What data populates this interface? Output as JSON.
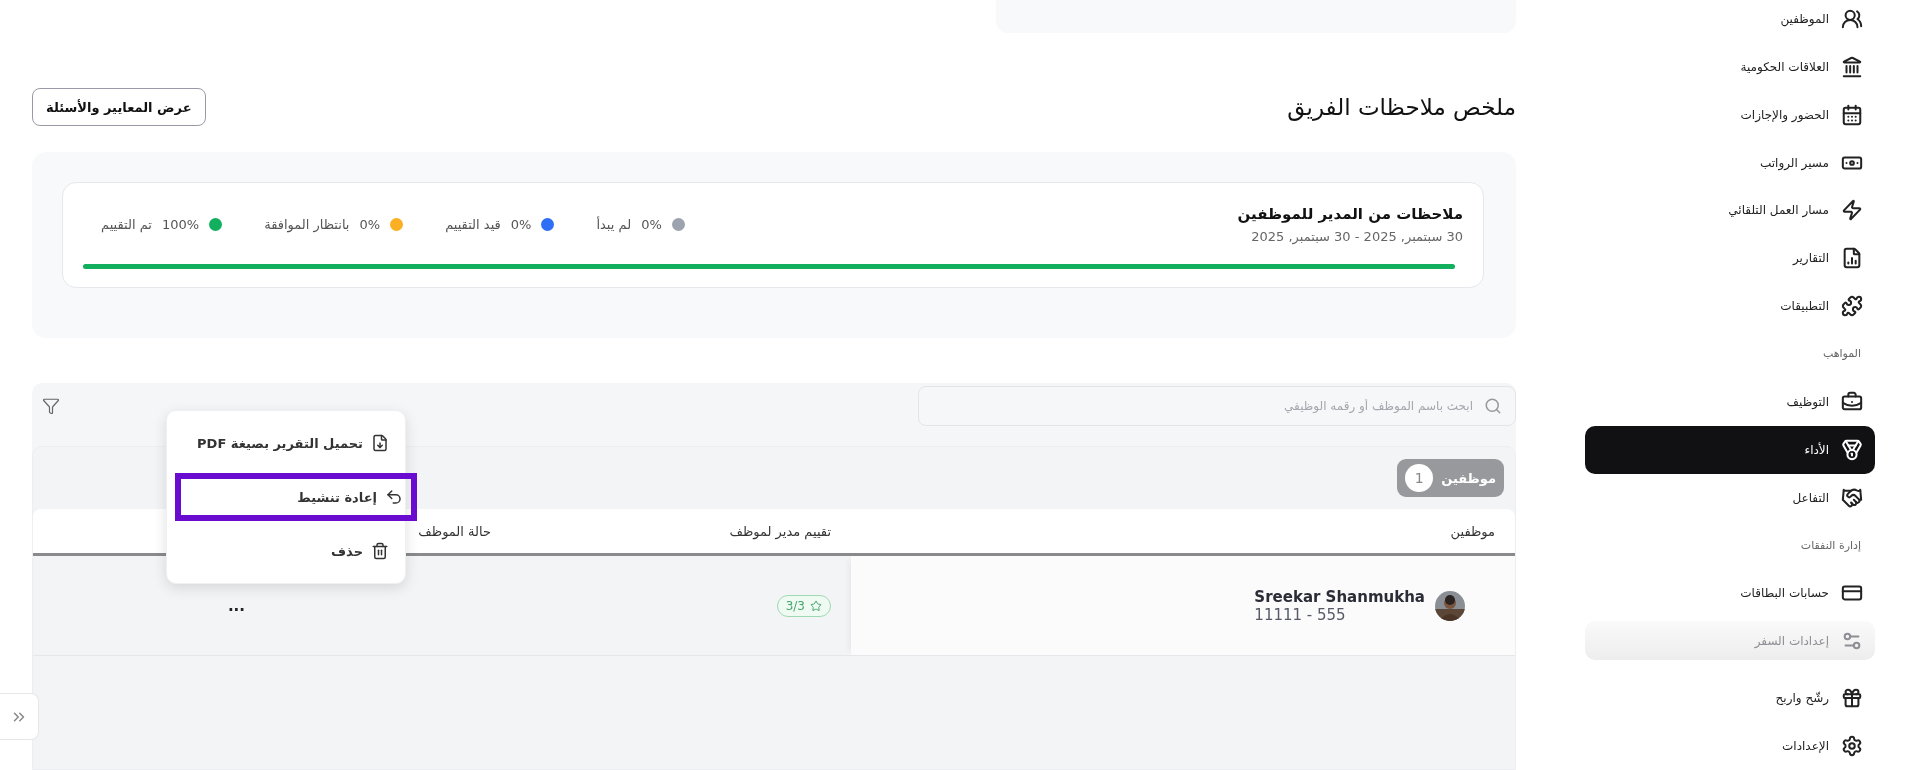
{
  "sidebar": {
    "items": [
      {
        "kind": "link",
        "label": "الموظفين",
        "selected": false,
        "disabled": false
      },
      {
        "kind": "link",
        "label": "العلاقات الحكومية",
        "selected": false,
        "disabled": false
      },
      {
        "kind": "link",
        "label": "الحضور والإجازات",
        "selected": false,
        "disabled": false
      },
      {
        "kind": "link",
        "label": "مسير الرواتب",
        "selected": false,
        "disabled": false
      },
      {
        "kind": "link",
        "label": "مسار العمل التلقائي",
        "selected": false,
        "disabled": false
      },
      {
        "kind": "link",
        "label": "التقارير",
        "selected": false,
        "disabled": false
      },
      {
        "kind": "link",
        "label": "التطبيقات",
        "selected": false,
        "disabled": false
      },
      {
        "kind": "section",
        "label": "المواهب"
      },
      {
        "kind": "link",
        "label": "التوظيف",
        "selected": false,
        "disabled": false
      },
      {
        "kind": "link",
        "label": "الأداء",
        "selected": true,
        "disabled": false
      },
      {
        "kind": "link",
        "label": "التفاعل",
        "selected": false,
        "disabled": false
      },
      {
        "kind": "section",
        "label": "إدارة النفقات"
      },
      {
        "kind": "link",
        "label": "حسابات البطاقات",
        "selected": false,
        "disabled": false
      },
      {
        "kind": "link",
        "label": "إعدادات السفر",
        "selected": false,
        "disabled": true
      },
      {
        "kind": "link",
        "label": "رشّح واربح",
        "selected": false,
        "disabled": false
      },
      {
        "kind": "link",
        "label": "الإعدادات",
        "selected": false,
        "disabled": false
      }
    ]
  },
  "page": {
    "title": "ملخص ملاحظات الفريق",
    "criteria_button": "عرض المعايير والأسئلة"
  },
  "summary": {
    "title": "ملاحظات من المدير للموظفين",
    "date_range": "30 سبتمبر, 2025 - 30 سبتمبر, 2025",
    "legend": [
      {
        "label": "لم يبدأ",
        "value": "0%",
        "color": "#9ca3af"
      },
      {
        "label": "قيد التقييم",
        "value": "0%",
        "color": "#2f6ff5"
      },
      {
        "label": "بانتظار الموافقة",
        "value": "0%",
        "color": "#fbb024"
      },
      {
        "label": "تم التقييم",
        "value": "100%",
        "color": "#12b05e"
      }
    ],
    "progress": {
      "level": 1
    }
  },
  "table": {
    "search": {
      "placeholder": "ابحث باسم الموظف أو رقمه الوظيفي"
    },
    "count_chip": {
      "label": "موظفين",
      "count": "1"
    },
    "columns": [
      "موظفين",
      "تقييم مدير لموظف",
      "حالة الموظف"
    ],
    "rows": [
      {
        "name": "Sreekar Shanmukha",
        "employee_id": "11111 - 555",
        "rating": "3/3",
        "actions": "..."
      }
    ]
  },
  "row_menu": {
    "items": [
      {
        "label": "تحميل التقرير بصيغة PDF",
        "highlighted": false
      },
      {
        "label": "إعادة تنشيط",
        "highlighted": true
      },
      {
        "label": "حذف",
        "highlighted": false
      }
    ]
  }
}
